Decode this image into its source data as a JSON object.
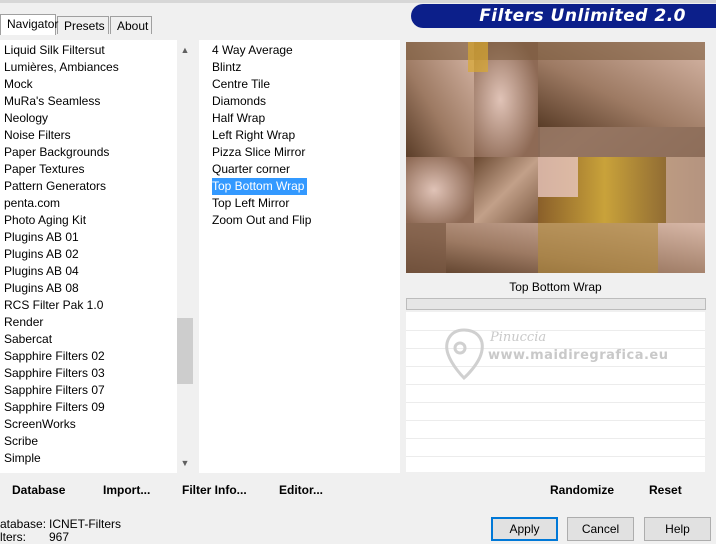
{
  "tabs": [
    {
      "label": "Navigator"
    },
    {
      "label": "Presets"
    },
    {
      "label": "About"
    }
  ],
  "banner_title": "Filters Unlimited 2.0",
  "categories": [
    "Liquid Silk Filtersut",
    "Lumières, Ambiances",
    "Mock",
    "MuRa's Seamless",
    "Neology",
    "Noise Filters",
    "Paper Backgrounds",
    "Paper Textures",
    "Pattern Generators",
    "penta.com",
    "Photo Aging Kit",
    "Plugins AB 01",
    "Plugins AB 02",
    "Plugins AB 04",
    "Plugins AB 08",
    "RCS Filter Pak 1.0",
    "Render",
    "Sabercat",
    "Sapphire Filters 02",
    "Sapphire Filters 03",
    "Sapphire Filters 07",
    "Sapphire Filters 09",
    "ScreenWorks",
    "Scribe",
    "Simple"
  ],
  "filters": [
    "4 Way Average",
    "Blintz",
    "Centre Tile",
    "Diamonds",
    "Half Wrap",
    "Left Right Wrap",
    "Pizza Slice Mirror",
    "Quarter corner",
    "Top Bottom Wrap",
    "Top Left Mirror",
    "Zoom Out and Flip"
  ],
  "selected_filter_index": 8,
  "preview_filter_name": "Top Bottom Wrap",
  "watermark": {
    "line1": "Pinuccia",
    "line2": "www.maidiregrafica.eu"
  },
  "bottom_buttons": {
    "database": "Database",
    "import": "Import...",
    "filter_info": "Filter Info...",
    "editor": "Editor...",
    "randomize": "Randomize",
    "reset": "Reset"
  },
  "status": {
    "database_label": "atabase:",
    "database_value": "ICNET-Filters",
    "filters_label": "lters:",
    "filters_value": "967"
  },
  "dialog_buttons": {
    "apply": "Apply",
    "cancel": "Cancel",
    "help": "Help"
  },
  "colors": {
    "selection": "#3399ff",
    "banner": "#0c1f8a",
    "default_button_border": "#0078d7"
  },
  "icons": {
    "scroll_up": "▲",
    "scroll_down": "▼"
  }
}
